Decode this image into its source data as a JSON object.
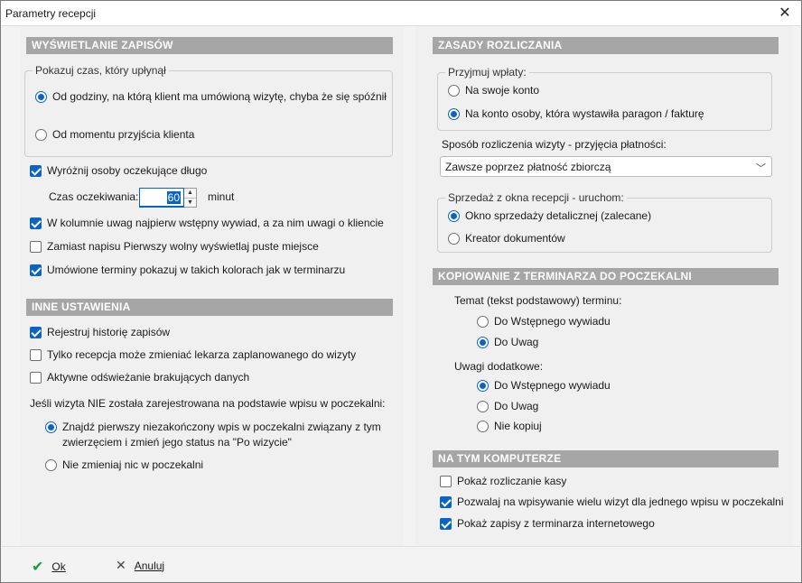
{
  "window": {
    "title": "Parametry recepcji",
    "close_glyph": "✕"
  },
  "left": {
    "display": {
      "header": "WYŚWIETLANIE ZAPISÓW",
      "elapsed_group_label": "Pokazuj czas, który upłynął",
      "elapsed_options": [
        {
          "label": "Od godziny, na którą klient ma umówioną wizytę, chyba że się spóźnił",
          "checked": true
        },
        {
          "label": "Od momentu przyjścia klienta",
          "checked": false
        }
      ],
      "highlight_waiting": "Wyróżnij osoby oczekujące długo",
      "wait_time_label": "Czas oczekiwania:",
      "wait_time_value": "60",
      "wait_time_unit": "minut",
      "notes_column": "W kolumnie uwag najpierw wstępny wywiad, a za nim uwagi o kliencie",
      "empty_slot": "Zamiast napisu Pierwszy wolny wyświetlaj puste miejsce",
      "colors": "Umówione terminy pokazuj w takich kolorach jak w terminarzu"
    },
    "other": {
      "header": "INNE USTAWIENIA",
      "history": "Rejestruj historię zapisów",
      "reception_only": "Tylko recepcja może zmieniać lekarza zaplanowanego do wizyty",
      "active_refresh": "Aktywne odświeżanie brakujących danych",
      "question": "Jeśli wizyta NIE została zarejestrowana na podstawie wpisu w poczekalni:",
      "find_option_line1": "Znajdź pierwszy niezakończony wpis w poczekalni związany z tym",
      "find_option_line2": "zwierzęciem i zmień jego status na \"Po wizycie\"",
      "no_change_option": "Nie zmieniaj nic w poczekalni"
    }
  },
  "right": {
    "billing": {
      "header": "ZASADY ROZLICZANIA",
      "accept_group_label": "Przyjmuj wpłaty:",
      "own_account": "Na swoje konto",
      "issuer_account": "Na konto osoby, która wystawiła paragon / fakturę",
      "method_label": "Sposób rozliczenia wizyty - przyjęcia płatności:",
      "method_value": "Zawsze poprzez płatność zbiorczą",
      "sale_group_label": "Sprzedaż z okna recepcji - uruchom:",
      "retail_window": "Okno sprzedaży detalicznej (zalecane)",
      "doc_wizard": "Kreator dokumentów"
    },
    "copy": {
      "header": "KOPIOWANIE Z TERMINARZA DO POCZEKALNI",
      "topic_label": "Temat (tekst podstawowy) terminu:",
      "topic_interview": "Do Wstępnego wywiadu",
      "topic_notes": "Do Uwag",
      "extra_label": "Uwagi dodatkowe:",
      "extra_interview": "Do Wstępnego wywiadu",
      "extra_notes": "Do Uwag",
      "extra_none": "Nie kopiuj"
    },
    "computer": {
      "header": "NA TYM KOMPUTERZE",
      "show_cash": "Pokaż rozliczanie kasy",
      "multi_visits": "Pozwalaj na wpisywanie wielu wizyt dla jednego wpisu w poczekalni",
      "online_entries": "Pokaż zapisy z terminarza internetowego"
    }
  },
  "footer": {
    "ok_label": "Ok",
    "cancel_label": "Anuluj"
  },
  "colors": {
    "accent": "#0a64c8",
    "section_header": "#a6a6a6",
    "ok_check": "#1f9a3a"
  }
}
